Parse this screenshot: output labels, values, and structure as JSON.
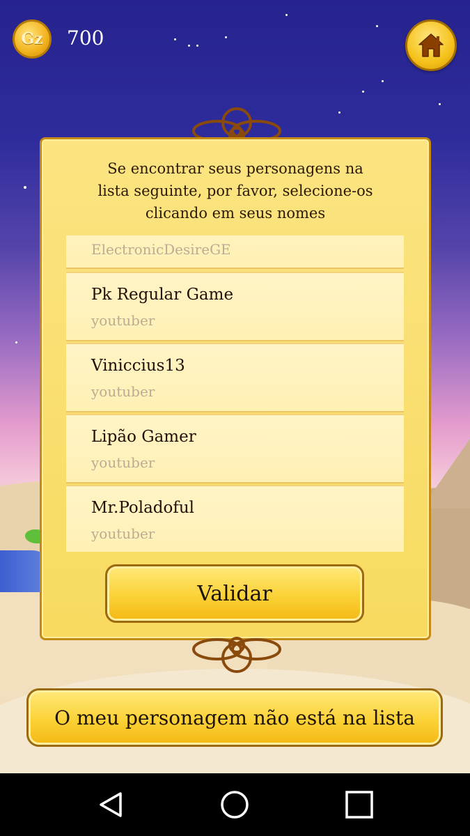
{
  "currency": {
    "coin_label": "Gz",
    "amount": "700"
  },
  "icons": {
    "home": "home-icon",
    "coin": "gz-coin-icon",
    "back": "back-triangle-icon",
    "home_nav": "circle-home-icon",
    "recents": "square-recents-icon"
  },
  "panel": {
    "instructions_line1": "Se encontrar seus personagens na",
    "instructions_line2": "lista seguinte, por favor, selecione-os",
    "instructions_line3": "clicando em seus nomes"
  },
  "characters": [
    {
      "name": "ElectronicDesireGE",
      "subtitle": ""
    },
    {
      "name": "Pk Regular Game",
      "subtitle": "youtuber"
    },
    {
      "name": "Viniccius13",
      "subtitle": "youtuber"
    },
    {
      "name": "Lipão Gamer",
      "subtitle": "youtuber"
    },
    {
      "name": "Mr.Poladoful",
      "subtitle": "youtuber"
    }
  ],
  "buttons": {
    "validate": "Validar",
    "not_listed": "O meu personagem não está na lista"
  },
  "colors": {
    "sky_top": "#26238e",
    "panel_bg": "#f8da60",
    "button_gold": "#fbd237",
    "row_bg": "#fff2bd",
    "subtitle_gray": "#b9ad93"
  }
}
